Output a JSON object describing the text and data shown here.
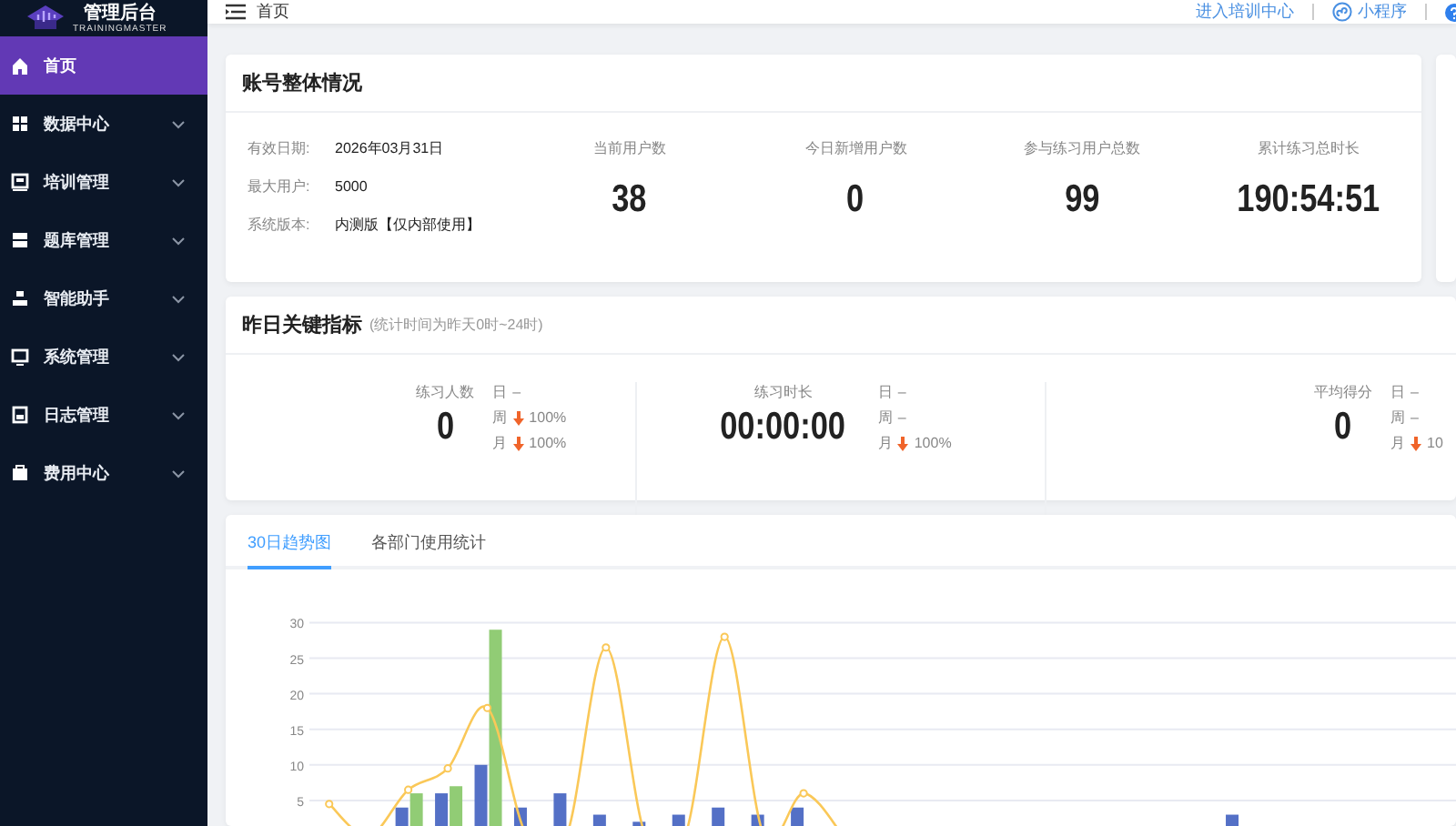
{
  "sidebar": {
    "logo": {
      "title": "管理后台",
      "subtitle": "TRAININGMASTER"
    },
    "items": [
      {
        "label": "首页",
        "selected": true,
        "has_submenu": false
      },
      {
        "label": "数据中心",
        "selected": false,
        "has_submenu": true
      },
      {
        "label": "培训管理",
        "selected": false,
        "has_submenu": true
      },
      {
        "label": "题库管理",
        "selected": false,
        "has_submenu": true
      },
      {
        "label": "智能助手",
        "selected": false,
        "has_submenu": true
      },
      {
        "label": "系统管理",
        "selected": false,
        "has_submenu": true
      },
      {
        "label": "日志管理",
        "selected": false,
        "has_submenu": true
      },
      {
        "label": "费用中心",
        "selected": false,
        "has_submenu": true
      }
    ]
  },
  "header": {
    "breadcrumb": "首页",
    "links": [
      {
        "label": "进入培训中心",
        "kind": "text"
      },
      {
        "label": "小程序",
        "kind": "icon"
      }
    ]
  },
  "account_overview": {
    "title": "账号整体情况",
    "info": [
      {
        "label": "有效日期:",
        "value": "2026年03月31日"
      },
      {
        "label": "最大用户:",
        "value": "5000"
      },
      {
        "label": "系统版本:",
        "value": "内测版【仅内部使用】"
      }
    ],
    "stats": [
      {
        "label": "当前用户数",
        "value": "38"
      },
      {
        "label": "今日新增用户数",
        "value": "0"
      },
      {
        "label": "参与练习用户总数",
        "value": "99"
      },
      {
        "label": "累计练习总时长",
        "value": "190:54:51"
      }
    ]
  },
  "key_metrics": {
    "title": "昨日关键指标",
    "subtitle": "(统计时间为昨天0时~24时)",
    "metrics": [
      {
        "label": "练习人数",
        "value": "0",
        "changes": [
          {
            "period": "日",
            "down": false,
            "text": "–"
          },
          {
            "period": "周",
            "down": true,
            "text": "100%"
          },
          {
            "period": "月",
            "down": true,
            "text": "100%"
          }
        ]
      },
      {
        "label": "练习时长",
        "value": "00:00:00",
        "changes": [
          {
            "period": "日",
            "down": false,
            "text": "–"
          },
          {
            "period": "周",
            "down": false,
            "text": "–"
          },
          {
            "period": "月",
            "down": true,
            "text": "100%"
          }
        ]
      },
      {
        "label": "平均得分",
        "value": "0",
        "changes": [
          {
            "period": "日",
            "down": false,
            "text": "–"
          },
          {
            "period": "周",
            "down": false,
            "text": "–"
          },
          {
            "period": "月",
            "down": true,
            "text": "10"
          }
        ]
      }
    ]
  },
  "trends": {
    "tabs": [
      {
        "label": "30日趋势图",
        "selected": true
      },
      {
        "label": "各部门使用统计",
        "selected": false
      }
    ],
    "chart_data": {
      "type": "bar",
      "grid": true,
      "ylim": [
        0,
        30
      ],
      "yticks": [
        5,
        10,
        15,
        20,
        25,
        30
      ],
      "series": [
        {
          "color": "#5470c6",
          "values": [
            0,
            0,
            4,
            6,
            10,
            4,
            6,
            3,
            2,
            3,
            4,
            3,
            4,
            0,
            0,
            0,
            0,
            0,
            0,
            0,
            0,
            0,
            0,
            3,
            0,
            0,
            0,
            0,
            0
          ]
        },
        {
          "color": "#91cc75",
          "values": [
            0,
            0,
            6,
            7,
            29,
            0,
            0,
            0,
            0,
            0,
            0,
            0,
            0,
            0,
            0,
            0,
            0,
            0,
            0,
            0,
            0,
            0,
            0,
            0,
            0,
            0,
            0,
            0,
            0
          ]
        },
        {
          "type": "line",
          "color": "#fac858",
          "values": [
            4.5,
            0,
            6.5,
            9.5,
            18,
            0,
            0,
            26.5,
            0,
            0,
            28,
            0,
            6,
            0,
            null,
            null,
            null,
            null,
            null,
            null,
            null,
            null,
            null,
            null,
            null,
            null,
            null,
            null,
            null
          ]
        }
      ]
    }
  }
}
